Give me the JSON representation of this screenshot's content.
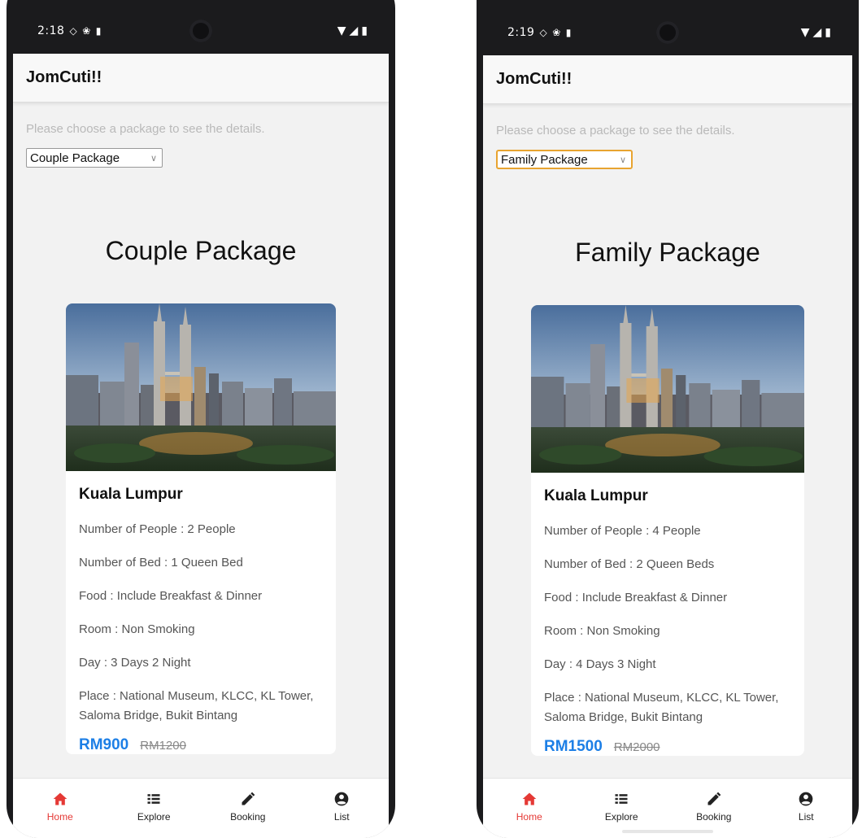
{
  "screens": [
    {
      "status": {
        "time": "2:18"
      },
      "app_title": "JomCuti!!",
      "hint": "Please choose a package to see the details.",
      "selected_package": "Couple Package",
      "package_title": "Couple Package",
      "card": {
        "city": "Kuala Lumpur",
        "details": [
          "Number of People : 2 People",
          "Number of Bed : 1 Queen Bed",
          "Food : Include Breakfast & Dinner",
          "Room : Non Smoking",
          "Day : 3 Days 2 Night",
          "Place : National Museum, KLCC, KL Tower, Saloma Bridge, Bukit Bintang"
        ],
        "price_now": "RM900",
        "price_old": "RM1200"
      }
    },
    {
      "status": {
        "time": "2:19"
      },
      "app_title": "JomCuti!!",
      "hint": "Please choose a package to see the details.",
      "selected_package": "Family Package",
      "package_title": "Family Package",
      "card": {
        "city": "Kuala Lumpur",
        "details": [
          "Number of People : 4 People",
          "Number of Bed : 2 Queen Beds",
          "Food : Include Breakfast & Dinner",
          "Room : Non Smoking",
          "Day : 4 Days 3 Night",
          "Place : National Museum, KLCC, KL Tower, Saloma Bridge, Bukit Bintang"
        ],
        "price_now": "RM1500",
        "price_old": "RM2000"
      }
    }
  ],
  "nav": [
    {
      "label": "Home",
      "icon": "home-icon",
      "active": true
    },
    {
      "label": "Explore",
      "icon": "list-icon",
      "active": false
    },
    {
      "label": "Booking",
      "icon": "pencil-icon",
      "active": false
    },
    {
      "label": "List",
      "icon": "account-circle-icon",
      "active": false
    }
  ],
  "colors": {
    "active_nav": "#e53935",
    "price": "#1d7fe6",
    "dropdown_focus": "#e8a430"
  }
}
